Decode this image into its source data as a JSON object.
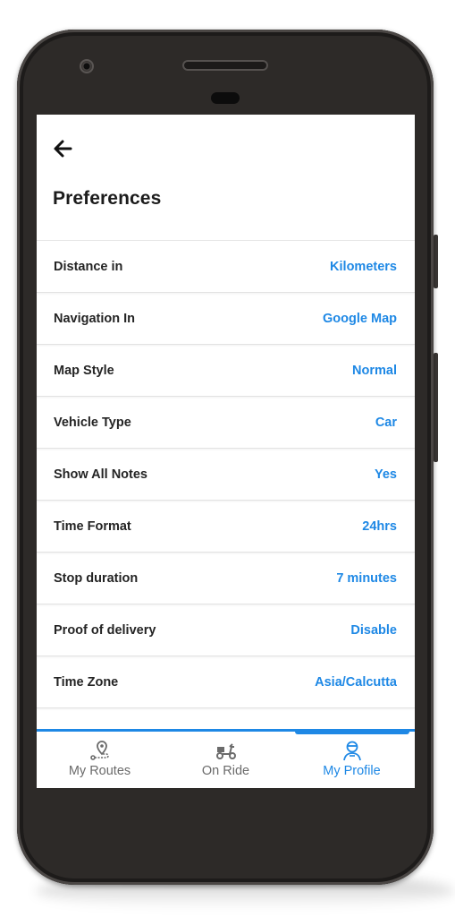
{
  "header": {
    "title": "Preferences",
    "back_icon": "arrow-left-icon"
  },
  "preferences": [
    {
      "label": "Distance in",
      "value": "Kilometers"
    },
    {
      "label": "Navigation In",
      "value": "Google Map"
    },
    {
      "label": "Map Style",
      "value": "Normal"
    },
    {
      "label": "Vehicle Type",
      "value": "Car"
    },
    {
      "label": "Show All Notes",
      "value": "Yes"
    },
    {
      "label": "Time Format",
      "value": "24hrs"
    },
    {
      "label": "Stop duration",
      "value": "7 minutes"
    },
    {
      "label": "Proof of delivery",
      "value": "Disable"
    },
    {
      "label": "Time Zone",
      "value": "Asia/Calcutta"
    }
  ],
  "tabs": [
    {
      "label": "My Routes",
      "icon": "route-pin-icon",
      "active": false
    },
    {
      "label": "On Ride",
      "icon": "scooter-icon",
      "active": false
    },
    {
      "label": "My Profile",
      "icon": "driver-profile-icon",
      "active": true
    }
  ],
  "colors": {
    "accent": "#1e88e5",
    "text": "#242424",
    "inactive_tab": "#6b6b6b",
    "phone_body": "#2d2a28"
  }
}
